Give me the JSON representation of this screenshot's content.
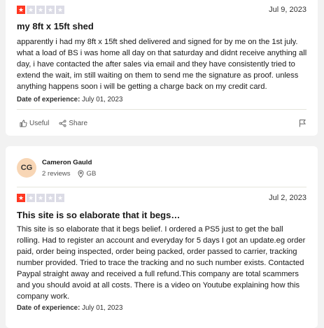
{
  "reviews": [
    {
      "rating": 1,
      "date": "Jul 9, 2023",
      "title": "my 8ft x 15ft shed",
      "body": "apparently i had my 8ft x 15ft shed delivered and signed for by me on the 1st july. what a load of BS i was home all day on that saturday and didnt receive anything all day, i have contacted the after sales via email and they have consistently tried to extend the wait, im still waiting on them to send me the signature as proof. unless anything happens soon i will be getting a charge back on my credit card.",
      "experience_label": "Date of experience:",
      "experience_date": "July 01, 2023",
      "useful_label": "Useful",
      "share_label": "Share"
    },
    {
      "reviewer": {
        "initials": "CG",
        "name": "Cameron Gauld",
        "reviews_count": "2 reviews",
        "country": "GB"
      },
      "rating": 1,
      "date": "Jul 2, 2023",
      "title": "This site is so elaborate that it begs…",
      "body": "This site is so elaborate that it begs belief. I ordered a PS5 just to get the ball rolling. Had to register an account and everyday for 5 days I got an update.eg order paid, order being inspected, order being packed, order passed to carrier, tracking number provided. Tried to trace the tracking and no such number exists. Contacted Paypal straight away and received a full refund.This company are total scammers and you should avoid at all costs. There is a video on Youtube explaining how this company work.",
      "experience_label": "Date of experience:",
      "experience_date": "July 01, 2023"
    }
  ],
  "colors": {
    "star_active": "#ff3722",
    "star_inactive": "#dcdce6",
    "avatar_bg": "#f8d6b5",
    "page_bg": "#f2f2f2"
  }
}
